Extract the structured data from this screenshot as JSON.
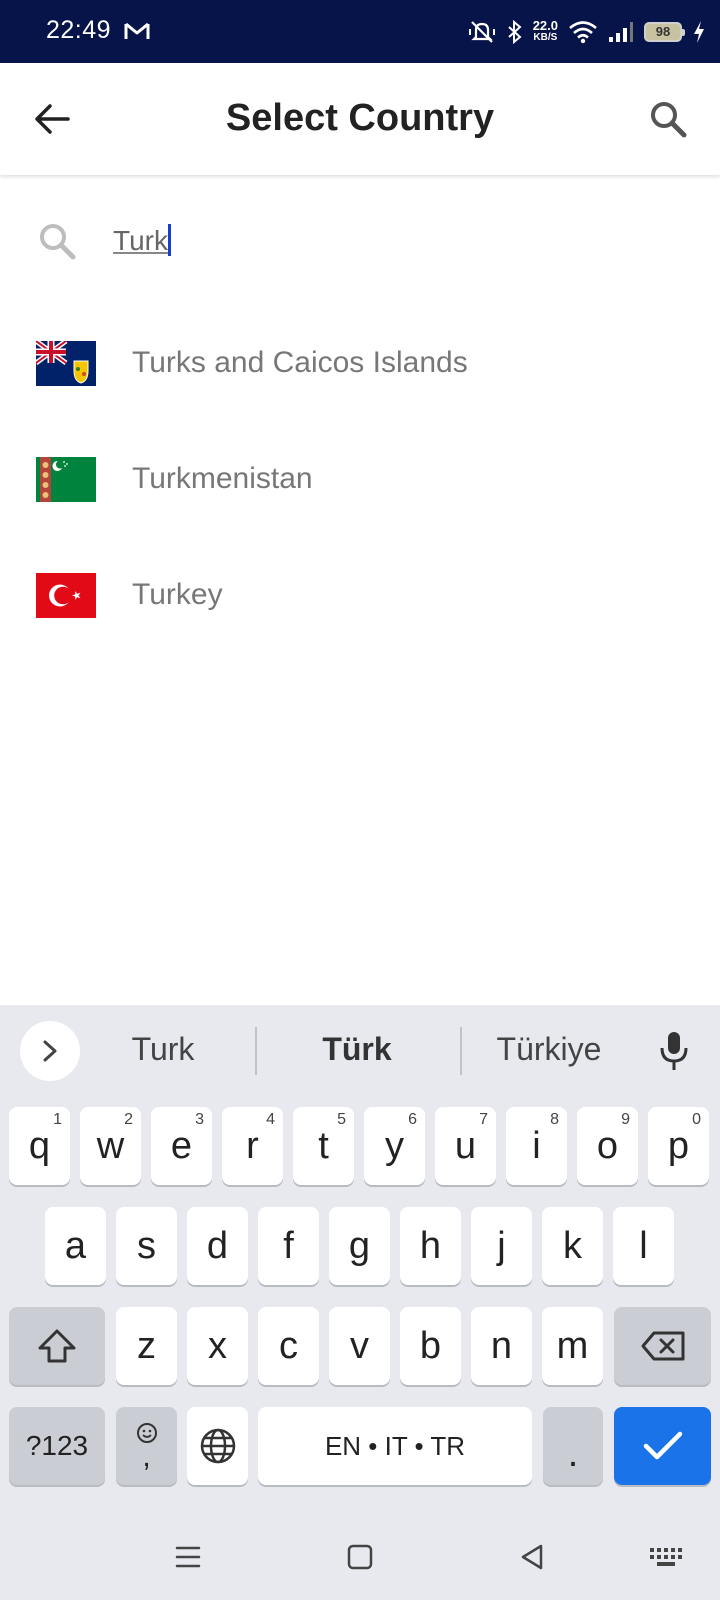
{
  "status_bar": {
    "time": "22:49",
    "net_speed_value": "22.0",
    "net_speed_unit": "KB/S",
    "battery_level": "98"
  },
  "app_bar": {
    "title": "Select Country"
  },
  "search": {
    "value": "Turk",
    "icon": "search-icon"
  },
  "countries": [
    {
      "name": "Turks and Caicos Islands",
      "flag": "turks-caicos-flag"
    },
    {
      "name": "Turkmenistan",
      "flag": "turkmenistan-flag"
    },
    {
      "name": "Turkey",
      "flag": "turkey-flag"
    }
  ],
  "keyboard": {
    "suggestions": [
      "Turk",
      "Türk",
      "Türkiye"
    ],
    "row1": [
      {
        "key": "q",
        "hint": "1"
      },
      {
        "key": "w",
        "hint": "2"
      },
      {
        "key": "e",
        "hint": "3"
      },
      {
        "key": "r",
        "hint": "4"
      },
      {
        "key": "t",
        "hint": "5"
      },
      {
        "key": "y",
        "hint": "6"
      },
      {
        "key": "u",
        "hint": "7"
      },
      {
        "key": "i",
        "hint": "8"
      },
      {
        "key": "o",
        "hint": "9"
      },
      {
        "key": "p",
        "hint": "0"
      }
    ],
    "row2": [
      "a",
      "s",
      "d",
      "f",
      "g",
      "h",
      "j",
      "k",
      "l"
    ],
    "row3": [
      "z",
      "x",
      "c",
      "v",
      "b",
      "n",
      "m"
    ],
    "symbols_label": "?123",
    "comma_label": ",",
    "space_label": "EN • IT • TR",
    "period_label": ".",
    "accent_color": "#1a73e8"
  }
}
